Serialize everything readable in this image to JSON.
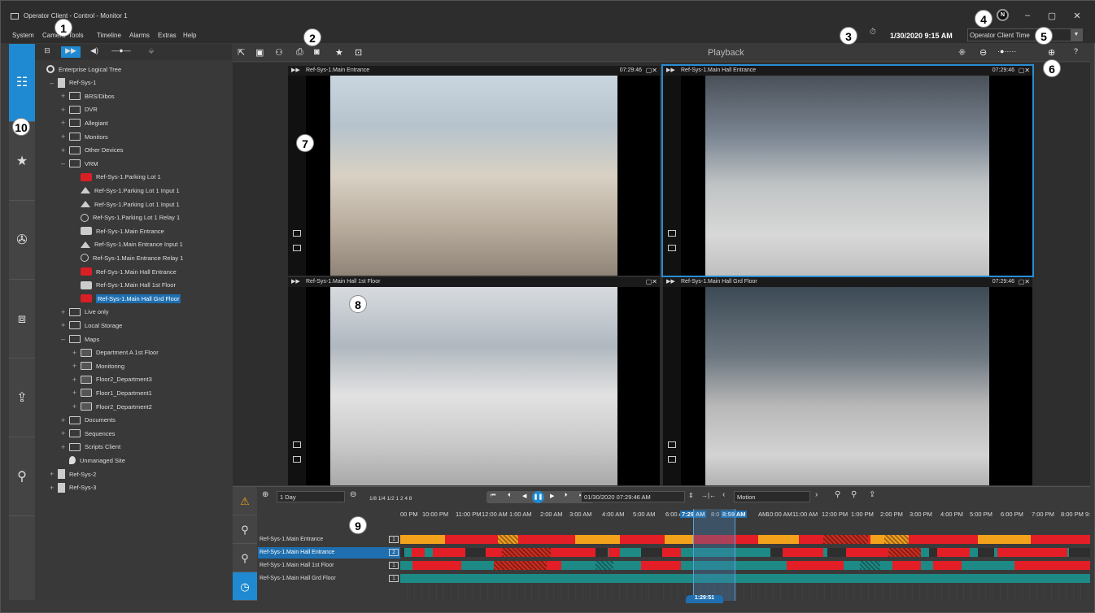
{
  "window": {
    "title": "Operator Client - Control - Monitor 1",
    "min": "–",
    "max": "▢",
    "close": "✕"
  },
  "menu": [
    "System",
    "Camera",
    "Tools",
    "Timeline",
    "Alarms",
    "Extras",
    "Help"
  ],
  "header": {
    "datetime": "1/30/2020 9:15 AM",
    "time_mode": "Operator Client Time",
    "avatar_letter": "N"
  },
  "callouts": [
    "1",
    "2",
    "3",
    "4",
    "5",
    "6",
    "7",
    "8",
    "9",
    "10"
  ],
  "toolbar": {
    "mode_label": "Playback"
  },
  "tree": {
    "root": "Enterprise Logical Tree",
    "items": [
      {
        "label": "Ref-Sys-1"
      },
      {
        "label": "BRS/Dibos"
      },
      {
        "label": "DVR"
      },
      {
        "label": "Allegiant"
      },
      {
        "label": "Monitors"
      },
      {
        "label": "Other Devices"
      },
      {
        "label": "VRM"
      },
      {
        "label": "Ref-Sys-1.Parking Lot 1"
      },
      {
        "label": "Ref-Sys-1.Parking Lot 1 Input 1"
      },
      {
        "label": "Ref-Sys-1.Parking Lot 1 Input 1"
      },
      {
        "label": "Ref-Sys-1.Parking Lot 1 Relay 1"
      },
      {
        "label": "Ref-Sys-1.Main Entrance"
      },
      {
        "label": "Ref-Sys-1.Main Entrance Input 1"
      },
      {
        "label": "Ref-Sys-1.Main Entrance Relay 1"
      },
      {
        "label": "Ref-Sys-1.Main Hall Entrance"
      },
      {
        "label": "Ref-Sys-1.Main Hall 1st Floor"
      },
      {
        "label": "Ref-Sys-1.Main Hall Grd Floor"
      },
      {
        "label": "Live only"
      },
      {
        "label": "Local Storage"
      },
      {
        "label": "Maps"
      },
      {
        "label": "Department A 1st Floor"
      },
      {
        "label": "Monitoring"
      },
      {
        "label": "Floor2_Department3"
      },
      {
        "label": "Floor1_Department1"
      },
      {
        "label": "Floor2_Department2"
      },
      {
        "label": "Documents"
      },
      {
        "label": "Sequences"
      },
      {
        "label": "Scripts Client"
      },
      {
        "label": "Unmanaged Site"
      },
      {
        "label": "Ref-Sys-2"
      },
      {
        "label": "Ref-Sys-3"
      }
    ]
  },
  "tiles": [
    {
      "name": "Ref-Sys-1.Main Entrance",
      "time": "07:29:46",
      "ctl": "▢✕"
    },
    {
      "name": "Ref-Sys-1.Main Hall Entrance",
      "time": "07:29:46",
      "ctl": "▢✕"
    },
    {
      "name": "Ref-Sys-1.Main Hall 1st Floor",
      "time": "",
      "ctl": "▢✕"
    },
    {
      "name": "Ref-Sys-1.Main Hall Grd Floor",
      "time": "07:29:46",
      "ctl": "▢✕"
    }
  ],
  "timeline": {
    "range": "1 Day",
    "speeds": "1/8 1/4 1/2  1  2  4  8",
    "datetime": "01/30/2020 07:29:46 AM",
    "filter": "Motion",
    "hours": [
      "00 PM",
      "10:00 PM",
      "11:00 PM",
      "12:00 AM",
      "1:00 AM",
      "2:00 AM",
      "3:00 AM",
      "4:00 AM",
      "5:00 AM",
      "6:00 AM",
      "7:29 AM",
      "8:0",
      "8:59 AM",
      "AM",
      "10:00 AM",
      "11:00 AM",
      "12:00 PM",
      "1:00 PM",
      "2:00 PM",
      "3:00 PM",
      "4:00 PM",
      "5:00 PM",
      "6:00 PM",
      "7:00 PM",
      "8:00 PM",
      "9:0"
    ],
    "tracks": [
      {
        "label": "Ref-Sys-1.Main Entrance",
        "num": "1"
      },
      {
        "label": "Ref-Sys-1.Main Hall Entrance",
        "num": "2"
      },
      {
        "label": "Ref-Sys-1.Main Hall 1st Floor",
        "num": "1"
      },
      {
        "label": "Ref-Sys-1.Main Hall Grd Floor",
        "num": "1"
      }
    ],
    "cursor": "1:29:51"
  },
  "colors": {
    "accent": "#1f8ad1",
    "motion": "#e31e26",
    "alarm": "#f3a21b",
    "recording": "#1d8a86"
  }
}
